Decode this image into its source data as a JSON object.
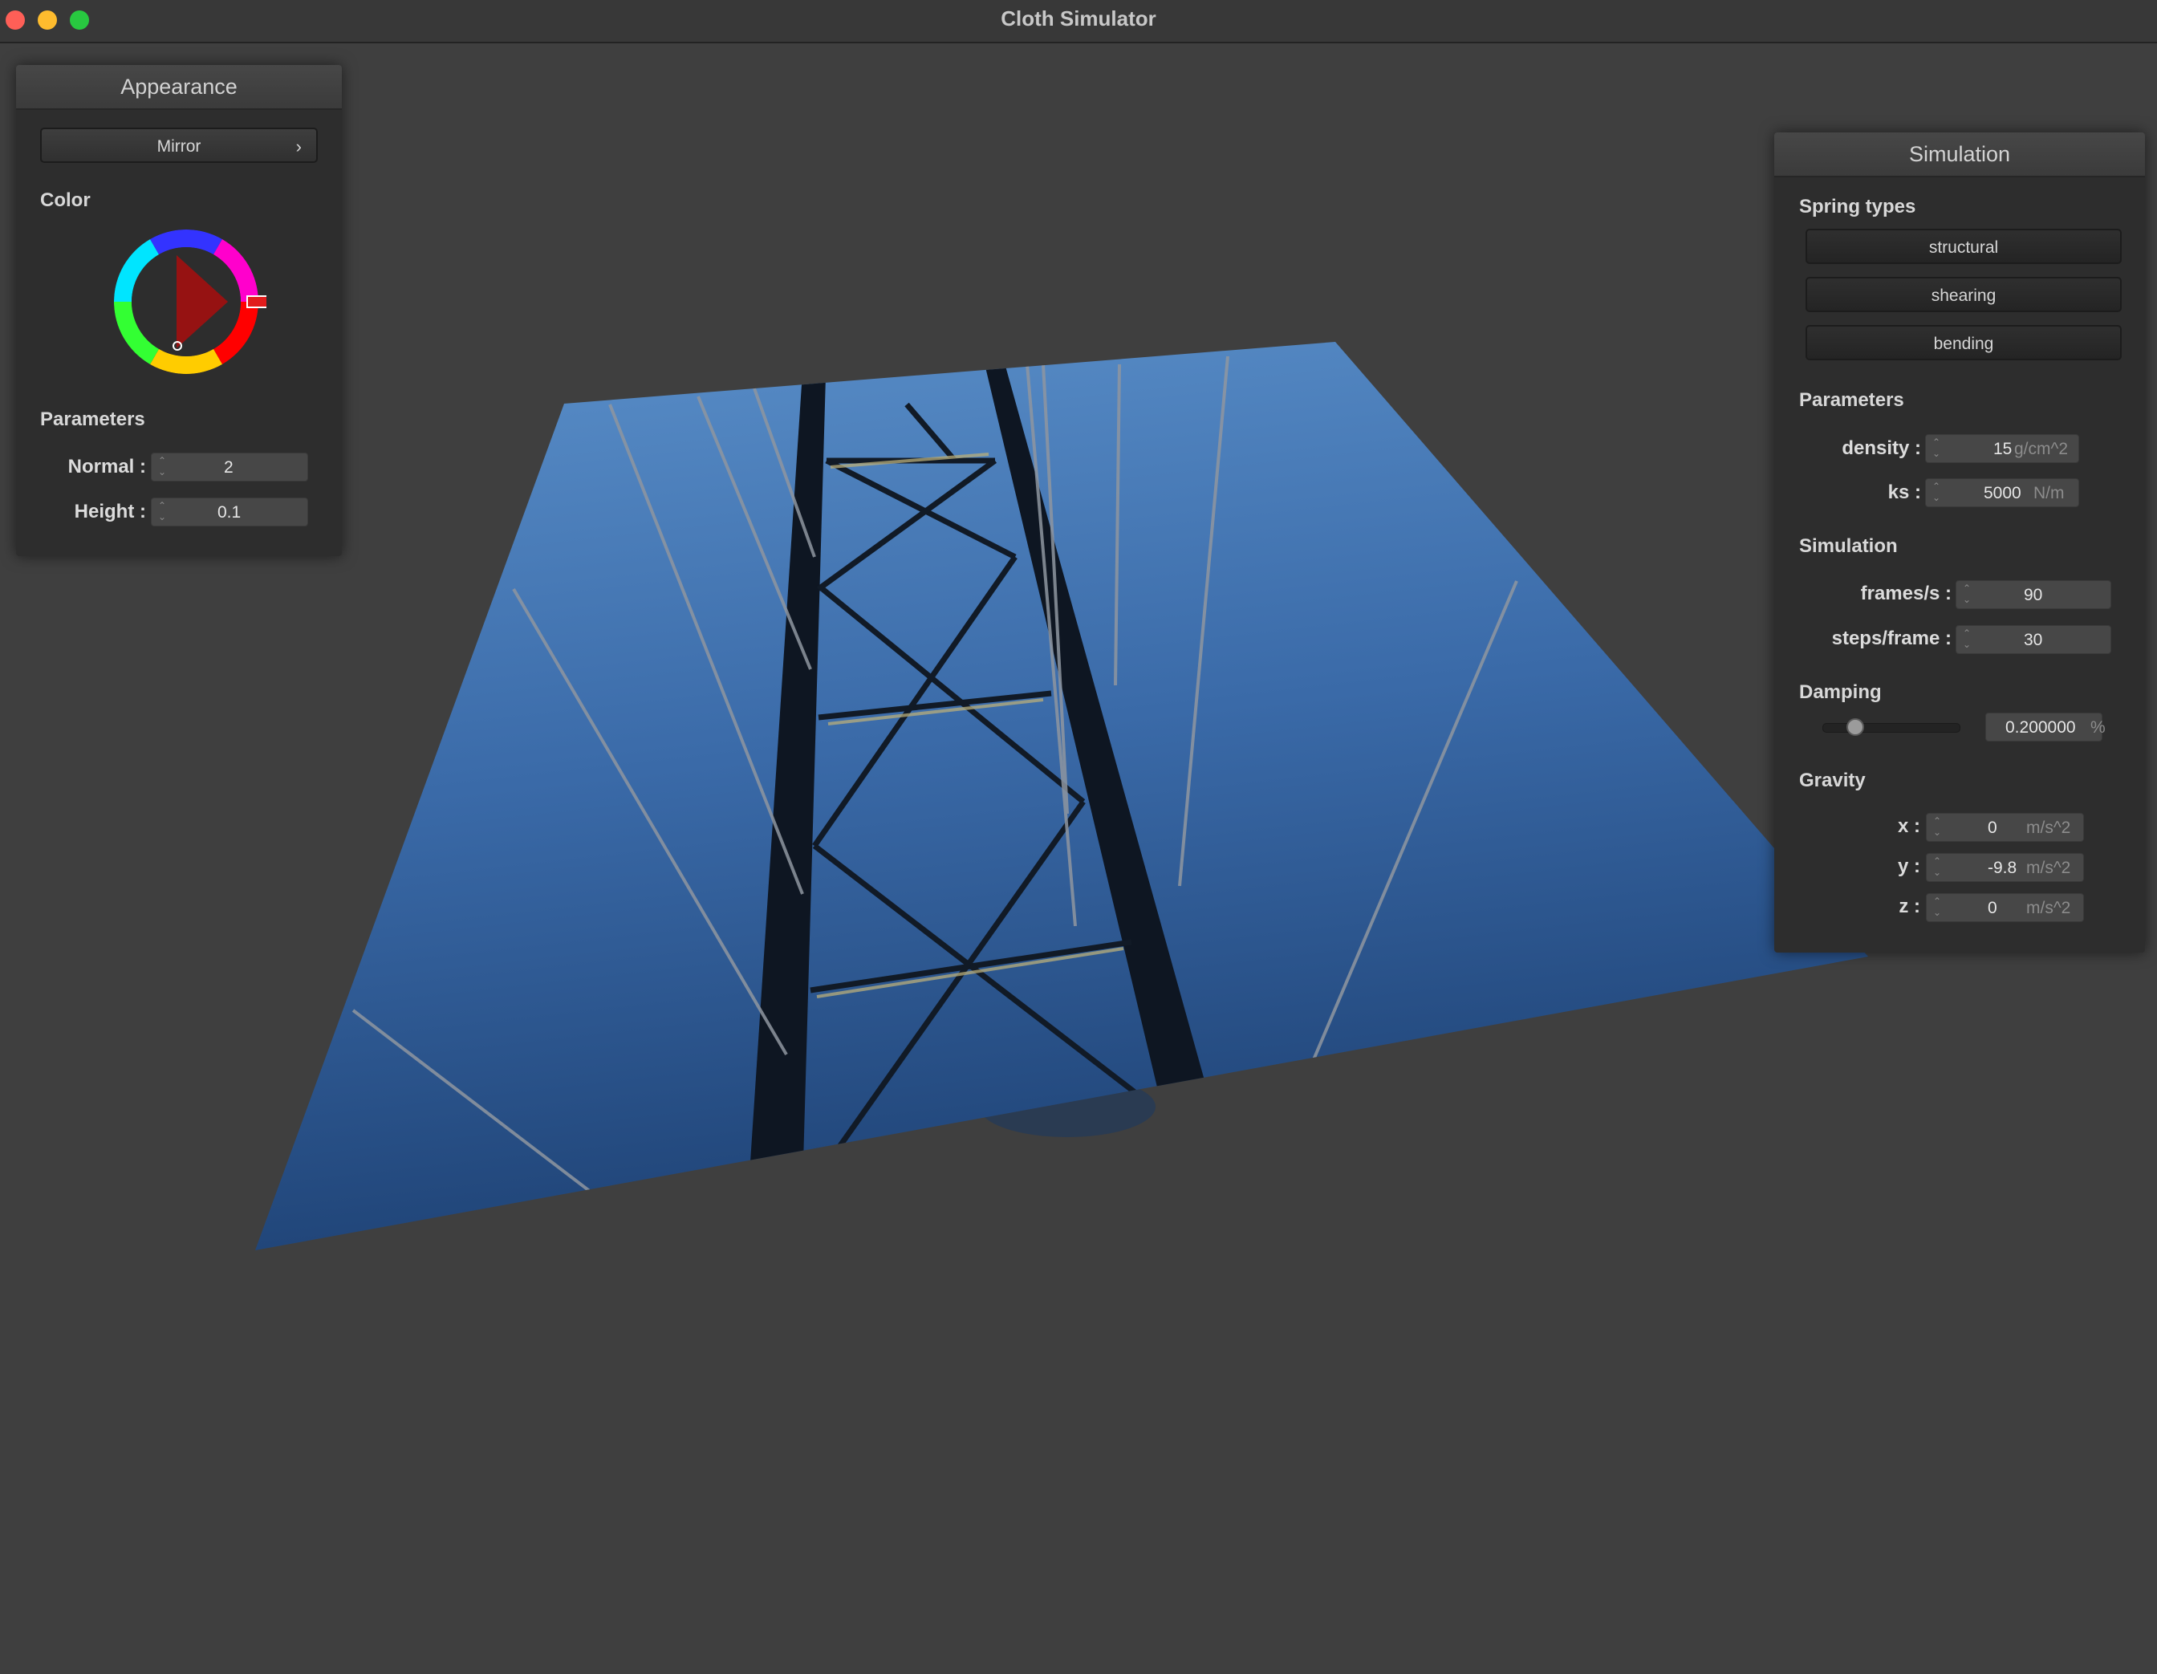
{
  "window": {
    "title": "Cloth Simulator"
  },
  "appearance": {
    "header": "Appearance",
    "shader_selected": "Mirror",
    "color_label": "Color",
    "color_value": "#e11d1d",
    "parameters_label": "Parameters",
    "normal": {
      "label": "Normal :",
      "value": "2"
    },
    "height": {
      "label": "Height :",
      "value": "0.1"
    }
  },
  "simulation": {
    "header": "Simulation",
    "spring_types_label": "Spring types",
    "spring_types": [
      "structural",
      "shearing",
      "bending"
    ],
    "parameters_label": "Parameters",
    "density": {
      "label": "density :",
      "value": "15",
      "unit": "g/cm^2"
    },
    "ks": {
      "label": "ks :",
      "value": "5000",
      "unit": "N/m"
    },
    "simulation_label": "Simulation",
    "frames_per_s": {
      "label": "frames/s :",
      "value": "90"
    },
    "steps_per_frame": {
      "label": "steps/frame :",
      "value": "30"
    },
    "damping_label": "Damping",
    "damping": {
      "value": "0.200000",
      "unit": "%",
      "slider_fraction": 0.2
    },
    "gravity_label": "Gravity",
    "gravity": [
      {
        "label": "x :",
        "value": "0",
        "unit": "m/s^2"
      },
      {
        "label": "y :",
        "value": "-9.8",
        "unit": "m/s^2"
      },
      {
        "label": "z :",
        "value": "0",
        "unit": "m/s^2"
      }
    ]
  },
  "colors": {
    "background": "#3f3f3f",
    "panel": "#2d2d2d",
    "sky_top": "#5a8fc9",
    "sky_bottom": "#1f4376"
  }
}
